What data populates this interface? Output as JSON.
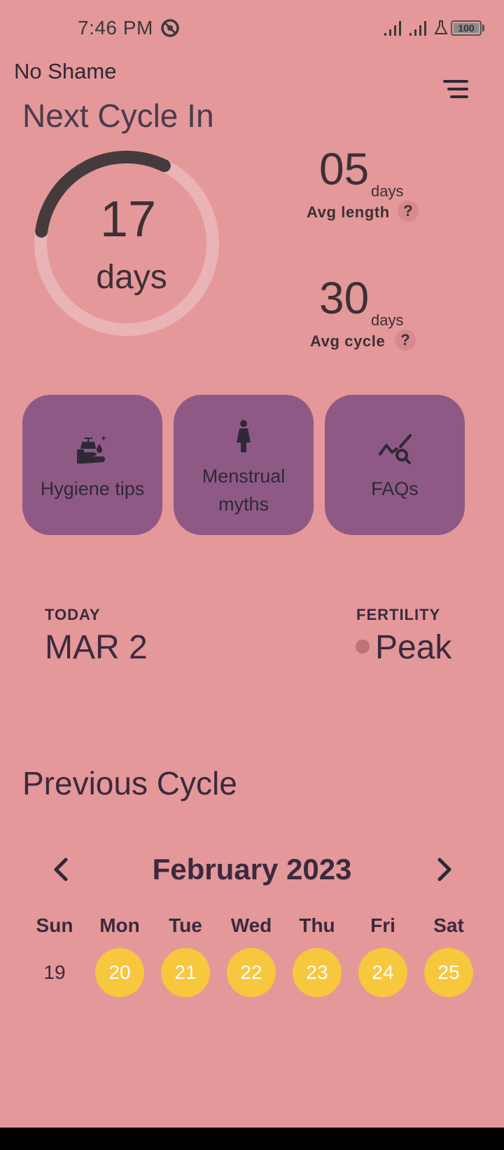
{
  "status_bar": {
    "time": "7:46 PM",
    "battery": "100",
    "battery_level": 1.0
  },
  "header": {
    "app_title": "No Shame"
  },
  "next_cycle": {
    "heading": "Next Cycle In",
    "days_value": "17",
    "days_unit": "days",
    "ring_progress": 0.3
  },
  "stats": [
    {
      "value": "05",
      "unit": "days",
      "label": "Avg length",
      "help": "?"
    },
    {
      "value": "30",
      "unit": "days",
      "label": "Avg cycle",
      "help": "?"
    }
  ],
  "actions": [
    {
      "label": "Hygiene tips",
      "icon": "hand-wash-icon"
    },
    {
      "label": "Menstrual myths",
      "label_lines": [
        "Menstrual",
        "myths"
      ],
      "icon": "woman-figure-icon"
    },
    {
      "label": "FAQs",
      "icon": "chart-search-icon"
    }
  ],
  "today": {
    "caption": "TODAY",
    "value": "MAR 2"
  },
  "fertility": {
    "caption": "FERTILITY",
    "value": "Peak"
  },
  "previous_cycle": {
    "heading": "Previous Cycle",
    "month": "February 2023",
    "weekdays": [
      "Sun",
      "Mon",
      "Tue",
      "Wed",
      "Thu",
      "Fri",
      "Sat"
    ],
    "days": [
      {
        "day": "19",
        "marked": false
      },
      {
        "day": "20",
        "marked": true
      },
      {
        "day": "21",
        "marked": true
      },
      {
        "day": "22",
        "marked": true
      },
      {
        "day": "23",
        "marked": true
      },
      {
        "day": "24",
        "marked": true
      },
      {
        "day": "25",
        "marked": true
      }
    ]
  },
  "colors": {
    "background": "#e4989a",
    "card": "#8e5a85",
    "marked_day": "#f7c73d",
    "ring_track": "#eab3b6",
    "ring_fill": "#453b3d"
  }
}
